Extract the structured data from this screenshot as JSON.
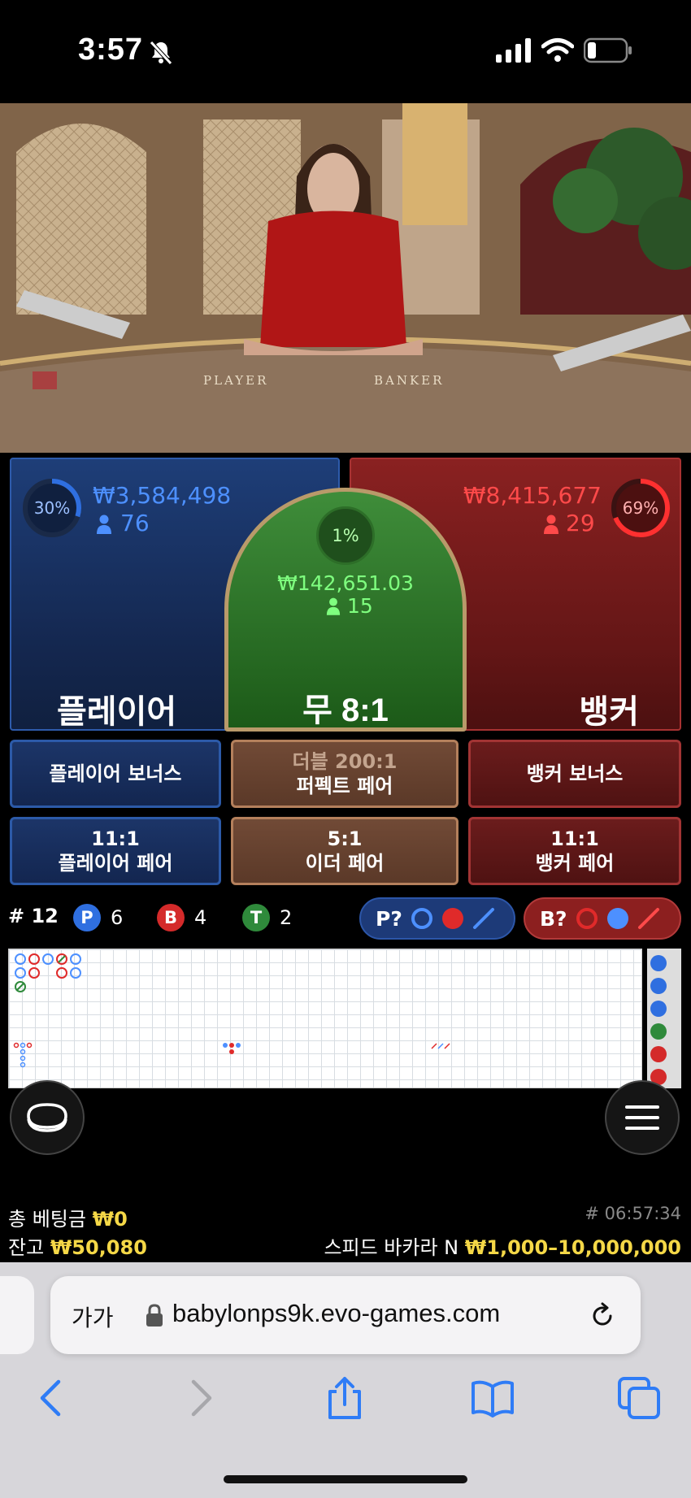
{
  "status_bar": {
    "time": "3:57"
  },
  "table": {
    "felt_player": "PLAYER",
    "felt_banker": "BANKER"
  },
  "bets": {
    "player": {
      "percent": "30%",
      "amount": "₩3,584,498",
      "players": "76",
      "label": "플레이어",
      "fraction": 0.3
    },
    "tie": {
      "percent": "1%",
      "amount": "₩142,651.03",
      "players": "15",
      "label": "무 8:1"
    },
    "banker": {
      "percent": "69%",
      "amount": "₩8,415,677",
      "players": "29",
      "label": "뱅커",
      "fraction": 0.69
    }
  },
  "side_bets": {
    "player_bonus": "플레이어 보너스",
    "perfect_pair_top": "더블 200:1",
    "perfect_pair_bottom": "퍼펙트 페어",
    "banker_bonus": "뱅커 보너스",
    "player_pair_odds": "11:1",
    "player_pair_label": "플레이어 페어",
    "either_pair_odds": "5:1",
    "either_pair_label": "이더 페어",
    "banker_pair_odds": "11:1",
    "banker_pair_label": "뱅커 페어"
  },
  "stats": {
    "round": "# 12",
    "player_letter": "P",
    "player_count": "6",
    "banker_letter": "B",
    "banker_count": "4",
    "tie_letter": "T",
    "tie_count": "2",
    "player_predict": "P?",
    "banker_predict": "B?"
  },
  "bottom": {
    "total_bet_label": "총 베팅금",
    "total_bet_value": "₩0",
    "balance_label": "잔고",
    "balance_value": "₩50,080",
    "game_id": "# 06:57:34",
    "game_name": "스피드 바카라 N",
    "limits": "₩1,000–10,000,000"
  },
  "browser": {
    "text_size": "가가",
    "url": "babylonps9k.evo-games.com"
  },
  "colors": {
    "player": "#2e5bab",
    "banker": "#a83232",
    "tie": "#2f8a2b",
    "gold": "#f5d847"
  }
}
